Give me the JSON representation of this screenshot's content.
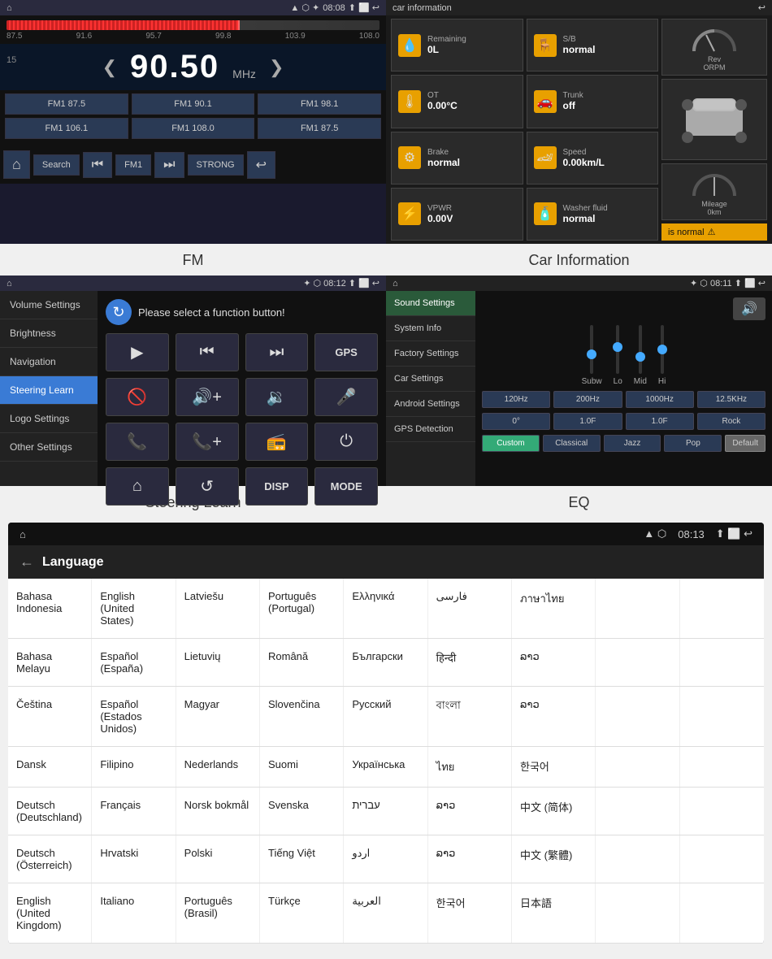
{
  "fm": {
    "statusbar": {
      "left": "⌂",
      "time": "08:08",
      "icons": [
        "▲",
        "⬡",
        "★",
        "↩"
      ]
    },
    "freq_min": "87.5",
    "freq_max": "108.0",
    "freq_marks": [
      "87.5",
      "91.6",
      "95.7",
      "99.8",
      "103.9",
      "108.0"
    ],
    "band": "15",
    "current_freq": "90.50",
    "freq_unit": "MHz",
    "presets": [
      [
        "FM1 87.5",
        "FM1 90.1",
        "FM1 98.1"
      ],
      [
        "FM1 106.1",
        "FM1 108.0",
        "FM1 87.5"
      ]
    ],
    "controls": {
      "home": "⌂",
      "search": "Search",
      "prev": "⏮",
      "band": "FM1",
      "next": "⏭",
      "signal": "STRONG",
      "back": "↩"
    }
  },
  "car_info": {
    "title": "car information",
    "cells": [
      {
        "icon": "💧",
        "label": "Remaining",
        "value": "0L"
      },
      {
        "icon": "🪑",
        "label": "S/B",
        "value": "normal"
      },
      {
        "icon": "🌡",
        "label": "OT",
        "value": "0.00°C"
      },
      {
        "icon": "🚗",
        "label": "Trunk",
        "value": "off"
      },
      {
        "icon": "⚙",
        "label": "Brake",
        "value": "normal"
      },
      {
        "icon": "🏎",
        "label": "Speed",
        "value": "0.00km/L"
      },
      {
        "icon": "⚡",
        "label": "VPWR",
        "value": "0.00V"
      },
      {
        "icon": "🧴",
        "label": "Washer fluid",
        "value": "normal"
      }
    ],
    "gauges": [
      {
        "label": "Rev\nORPM"
      },
      {
        "label": "Mileage\n0km"
      }
    ],
    "warning": "is normal",
    "warning_icon": "⚠"
  },
  "steering": {
    "statusbar": {
      "left": "⌂",
      "time": "08:12",
      "icons": [
        "▲",
        "✦",
        "⬡",
        "↩"
      ]
    },
    "prompt": "Please select a function button!",
    "menu_items": [
      "Volume Settings",
      "Brightness",
      "Navigation",
      "Steering Learn",
      "Logo Settings",
      "Other Settings"
    ],
    "active_menu": "Steering Learn",
    "buttons": [
      {
        "label": "▶",
        "type": "icon"
      },
      {
        "label": "⏮",
        "type": "icon"
      },
      {
        "label": "⏭",
        "type": "icon"
      },
      {
        "label": "GPS",
        "type": "label"
      },
      {
        "label": "🚫",
        "type": "icon"
      },
      {
        "label": "🔊+",
        "type": "icon"
      },
      {
        "label": "🔊-",
        "type": "icon"
      },
      {
        "label": "🎤",
        "type": "icon"
      },
      {
        "label": "📞",
        "type": "icon"
      },
      {
        "label": "📞+",
        "type": "icon"
      },
      {
        "label": "📻",
        "type": "icon"
      },
      {
        "label": "⏻",
        "type": "icon"
      },
      {
        "label": "⌂",
        "type": "icon"
      },
      {
        "label": "↺",
        "type": "icon"
      },
      {
        "label": "DISP",
        "type": "label"
      },
      {
        "label": "MODE",
        "type": "label"
      }
    ]
  },
  "eq": {
    "statusbar": {
      "left": "⌂",
      "time": "08:11",
      "icons": [
        "▲",
        "⬡",
        "★",
        "↩"
      ]
    },
    "menu_items": [
      "Sound Settings",
      "System Info",
      "Factory Settings",
      "Car Settings",
      "Android Settings",
      "GPS Detection"
    ],
    "active_menu": "Sound Settings",
    "sliders": [
      {
        "label": "Subw",
        "position": 0.5
      },
      {
        "label": "Lo",
        "position": 0.65
      },
      {
        "label": "Mid",
        "position": 0.45
      },
      {
        "label": "Hi",
        "position": 0.6
      }
    ],
    "freq_buttons": [
      "120Hz",
      "200Hz",
      "1000Hz",
      "12.5KHz"
    ],
    "val_buttons": [
      "0°",
      "1.0F",
      "1.0F",
      "Rock"
    ],
    "presets": [
      {
        "label": "Custom",
        "active": true
      },
      {
        "label": "Classical",
        "active": false
      },
      {
        "label": "Jazz",
        "active": false
      },
      {
        "label": "Pop",
        "active": false
      }
    ],
    "default_btn": "Default",
    "speaker_btn": "🔊"
  },
  "language": {
    "statusbar": {
      "left": "⌂",
      "time": "08:13",
      "icons": [
        "▲",
        "⬡",
        "⬜",
        "↩"
      ]
    },
    "header": "Language",
    "back": "←",
    "rows": [
      [
        "Bahasa Indonesia",
        "English (United States)",
        "Latviešu",
        "Português (Portugal)",
        "Ελληνικά",
        "فارسی",
        "ภาษาไทย",
        "",
        ""
      ],
      [
        "Bahasa Melayu",
        "Español (España)",
        "Lietuvių",
        "Română",
        "Български",
        "हिन्दी",
        "ລາວ",
        "",
        ""
      ],
      [
        "Čeština",
        "Español (Estados Unidos)",
        "Magyar",
        "Slovenčina",
        "Русский",
        "বাংলা",
        "ລາວ",
        "",
        ""
      ],
      [
        "Dansk",
        "Filipino",
        "Nederlands",
        "Suomi",
        "Українська",
        "ไทย",
        "한국어",
        "",
        ""
      ],
      [
        "Deutsch (Deutschland)",
        "Français",
        "Norsk bokmål",
        "Svenska",
        "עברית",
        "ລາວ",
        "中文 (简体)",
        "",
        ""
      ],
      [
        "Deutsch (Österreich)",
        "Hrvatski",
        "Polski",
        "Tiếng Việt",
        "اردو",
        "ລາວ",
        "中文 (繁體)",
        "",
        ""
      ],
      [
        "English (United Kingdom)",
        "Italiano",
        "Português (Brasil)",
        "Türkçe",
        "العربية",
        "한국어",
        "日本語",
        "",
        ""
      ]
    ]
  },
  "labels": {
    "fm": "FM",
    "car_information": "Car Information",
    "steering_learn": "Steering Learn",
    "eq": "EQ"
  }
}
